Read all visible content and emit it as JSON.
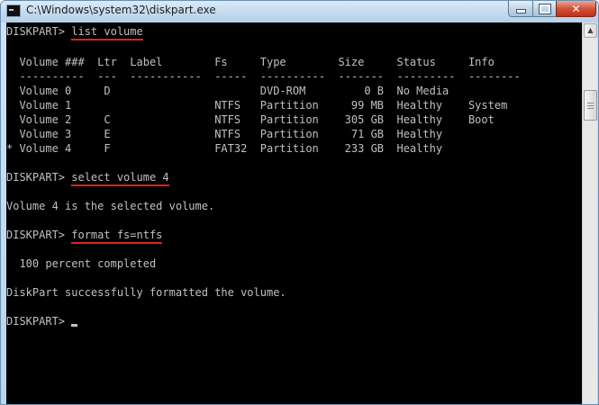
{
  "window": {
    "title": "C:\\Windows\\system32\\diskpart.exe"
  },
  "console": {
    "prompt": "DISKPART> ",
    "cmd1": "list volume",
    "table_header": "  Volume ###  Ltr  Label        Fs     Type        Size     Status     Info",
    "table_separator": "  ----------  ---  -----------  -----  ----------  -------  ---------  --------",
    "rows": [
      "  Volume 0     D                       DVD-ROM         0 B  No Media",
      "  Volume 1                      NTFS   Partition     99 MB  Healthy    System",
      "  Volume 2     C                NTFS   Partition    305 GB  Healthy    Boot",
      "  Volume 3     E                NTFS   Partition     71 GB  Healthy",
      "* Volume 4     F                FAT32  Partition    233 GB  Healthy"
    ],
    "cmd2": "select volume 4",
    "msg_selected": "Volume 4 is the selected volume.",
    "cmd3": "format fs=ntfs",
    "msg_progress": "  100 percent completed",
    "msg_success": "DiskPart successfully formatted the volume."
  },
  "icons": {
    "app": "console-icon",
    "minimize": "minimize-icon",
    "maximize": "maximize-icon",
    "close": "close-icon",
    "scroll_up": "arrow-up-icon"
  },
  "colors": {
    "console_bg": "#000000",
    "console_text": "#c0c0c0",
    "highlight_underline": "#e2231a",
    "close_button": "#c1301a"
  }
}
